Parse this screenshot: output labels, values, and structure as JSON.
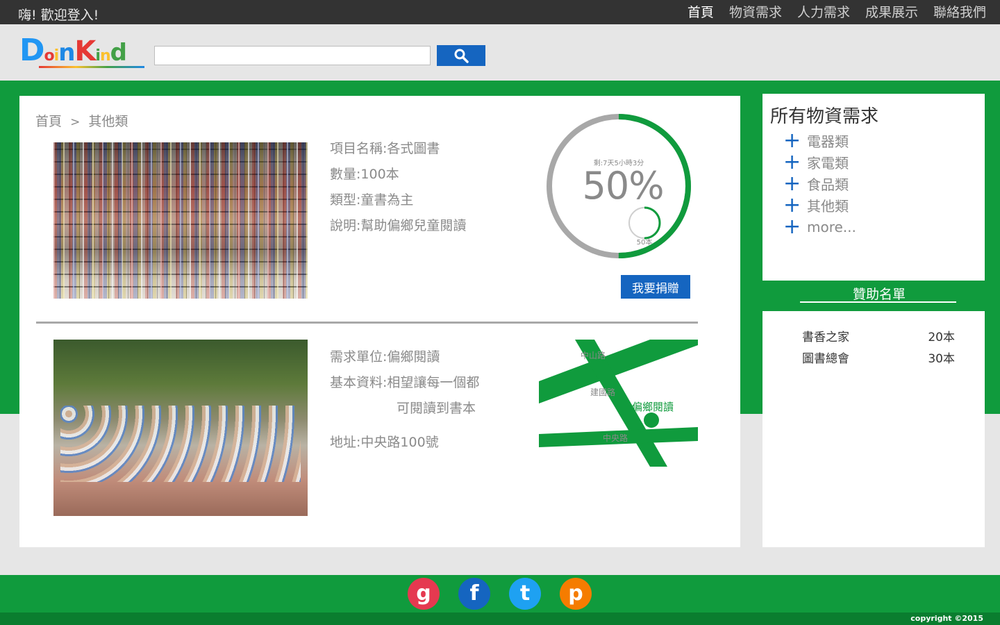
{
  "topbar": {
    "welcome": "嗨! 歡迎登入!",
    "nav": [
      "首頁",
      "物資需求",
      "人力需求",
      "成果展示",
      "聯絡我們"
    ]
  },
  "logo": {
    "text": "DoinKind",
    "colors": [
      "#2196f3",
      "#e53935",
      "#fbc02d",
      "#1e88e5",
      "#e53935",
      "#43a047",
      "#fbc02d",
      "#43a047"
    ]
  },
  "search": {
    "value": "",
    "placeholder": "",
    "icon": "search-icon"
  },
  "breadcrumb": {
    "home": "首頁",
    "sep": ">",
    "current": "其他類"
  },
  "item": {
    "name": "項目名稱:各式圖書",
    "quantity": "數量:100本",
    "type": "類型:童書為主",
    "description": "說明:幫助偏鄉兒童閱讀"
  },
  "progress": {
    "remaining": "剩:7天5小時3分",
    "percent_label": "50%",
    "fraction": 0.5,
    "count": "50本",
    "count_fraction": 0.5
  },
  "donate_label": "我要捐贈",
  "requester": {
    "unit": "需求單位:偏鄉閱讀",
    "info_line1": "基本資料:相望讓每一個都",
    "info_line2": "可閱讀到書本",
    "address": "地址:中央路100號"
  },
  "map": {
    "road1": "中山路",
    "road2": "建國路",
    "road3": "中央路",
    "place": "偏鄉閱讀"
  },
  "sidebar": {
    "title": "所有物資需求",
    "categories": [
      "電器類",
      "家電類",
      "食品類",
      "其他類",
      "more..."
    ],
    "sponsor_title": "贊助名單",
    "sponsors": [
      {
        "name": "書香之家",
        "amount": "20本"
      },
      {
        "name": "圖書總會",
        "amount": "30本"
      }
    ]
  },
  "footer": {
    "social": [
      {
        "icon": "google-icon",
        "glyph": "g",
        "color": "#e53950"
      },
      {
        "icon": "facebook-icon",
        "glyph": "f",
        "color": "#1565c0"
      },
      {
        "icon": "twitter-icon",
        "glyph": "t",
        "color": "#1ea1f2"
      },
      {
        "icon": "pinterest-icon",
        "glyph": "p",
        "color": "#f57c00"
      }
    ],
    "copyright": "copyright ©2015"
  },
  "colors": {
    "green": "#109b3d",
    "blue": "#1565c0",
    "grey_ring": "#a8a8a8"
  }
}
